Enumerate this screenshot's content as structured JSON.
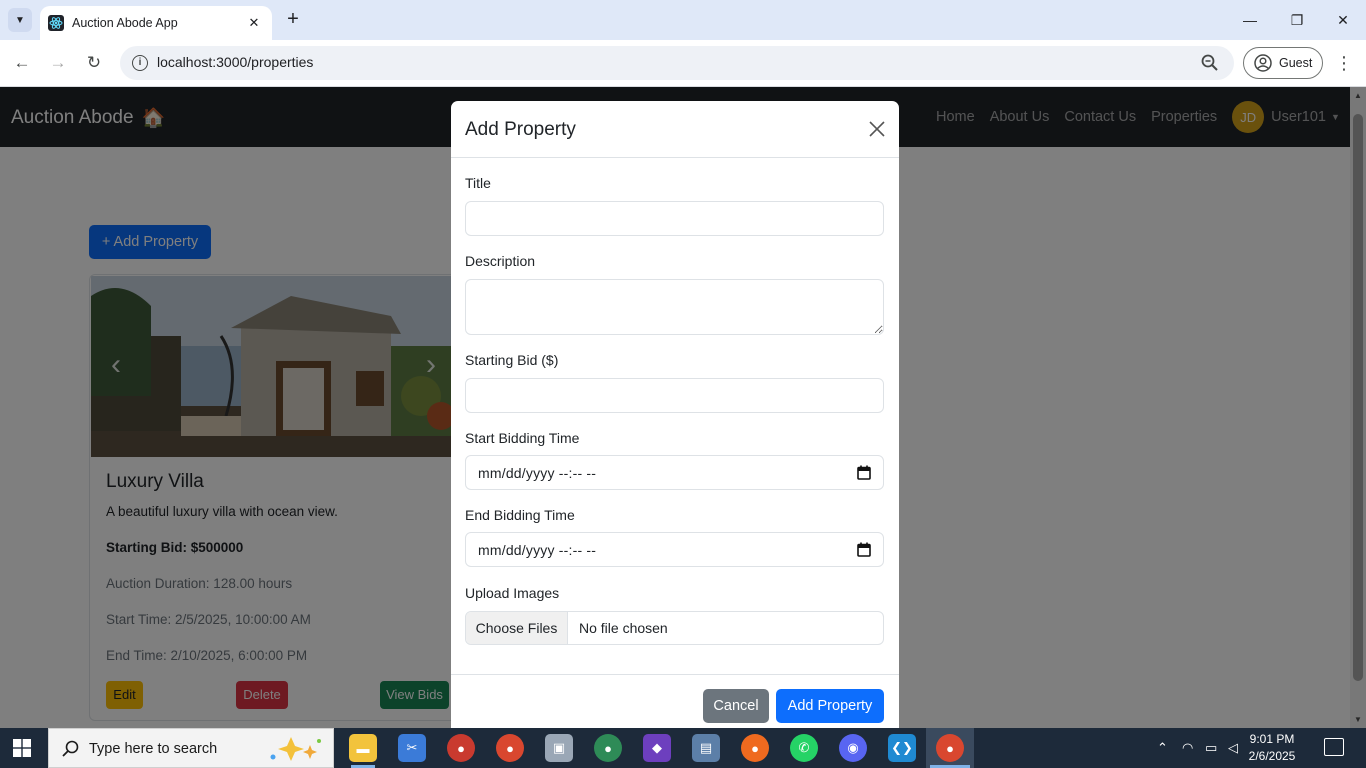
{
  "browser": {
    "tab_title": "Auction Abode App",
    "url": "localhost:3000/properties",
    "profile_label": "Guest"
  },
  "navbar": {
    "brand": "Auction Abode",
    "brand_emoji": "🏠",
    "links": [
      "Home",
      "About Us",
      "Contact Us",
      "Properties"
    ],
    "avatar_initials": "JD",
    "user_name": "User101"
  },
  "page": {
    "add_property_label": "+ Add Property",
    "card": {
      "title": "Luxury Villa",
      "description": "A beautiful luxury villa with ocean view.",
      "starting_bid": "Starting Bid: $500000",
      "duration": "Auction Duration: 128.00 hours",
      "start_time": "Start Time: 2/5/2025, 10:00:00 AM",
      "end_time": "End Time: 2/10/2025, 6:00:00 PM",
      "edit_label": "Edit",
      "delete_label": "Delete",
      "view_bids_label": "View Bids"
    }
  },
  "modal": {
    "title": "Add Property",
    "fields": {
      "title_label": "Title",
      "title_value": "",
      "description_label": "Description",
      "description_value": "",
      "starting_bid_label": "Starting Bid ($)",
      "starting_bid_value": "",
      "start_time_label": "Start Bidding Time",
      "start_time_placeholder": "mm/dd/yyyy --:-- --",
      "end_time_label": "End Bidding Time",
      "end_time_placeholder": "mm/dd/yyyy --:-- --",
      "upload_label": "Upload Images",
      "choose_files_label": "Choose Files",
      "file_status": "No file chosen"
    },
    "cancel_label": "Cancel",
    "submit_label": "Add Property"
  },
  "taskbar": {
    "search_placeholder": "Type here to search",
    "time": "9:01 PM",
    "date": "2/6/2025"
  },
  "colors": {
    "primary": "#0d6efd",
    "secondary": "#6c757d",
    "warning": "#ffc107",
    "danger": "#dc3545",
    "success": "#198754",
    "navbar": "#212529"
  }
}
